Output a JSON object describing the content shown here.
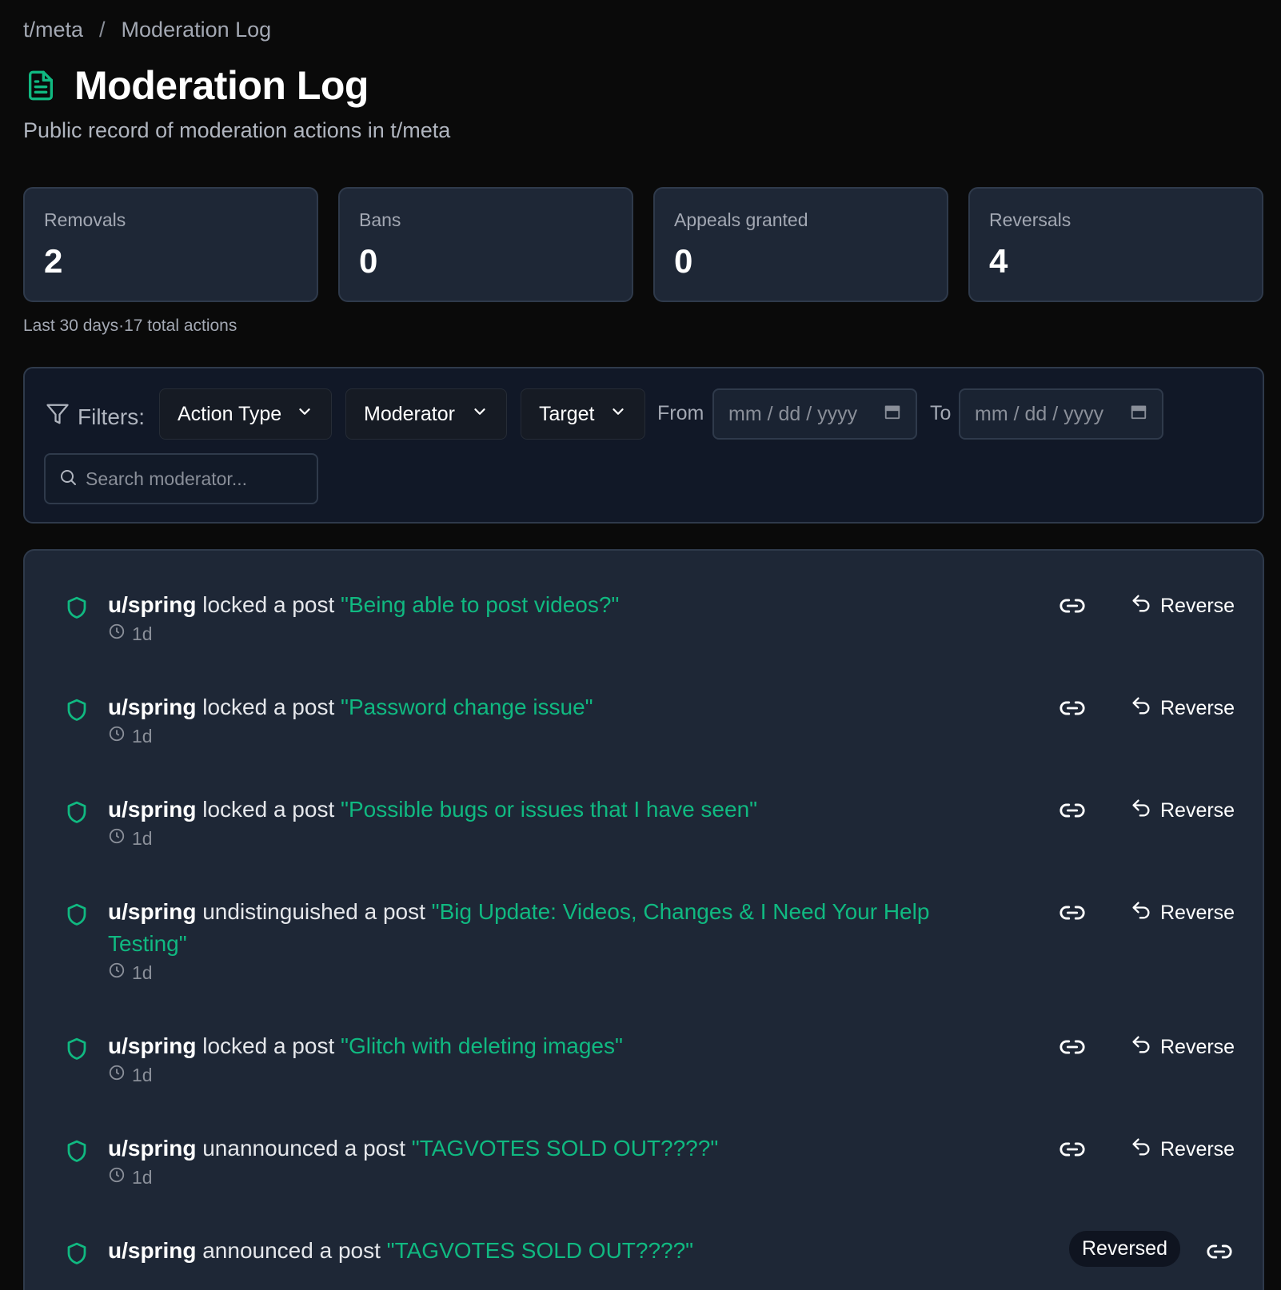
{
  "breadcrumb": {
    "community": "t/meta",
    "separator": "/",
    "current": "Moderation Log"
  },
  "header": {
    "title": "Moderation Log",
    "subtitle": "Public record of moderation actions in t/meta",
    "icon": "document-icon"
  },
  "stats": [
    {
      "label": "Removals",
      "value": "2"
    },
    {
      "label": "Bans",
      "value": "0"
    },
    {
      "label": "Appeals granted",
      "value": "0"
    },
    {
      "label": "Reversals",
      "value": "4"
    }
  ],
  "summary": {
    "period": "Last 30 days",
    "dot": "·",
    "total": "17 total actions"
  },
  "filters": {
    "label": "Filters:",
    "action_type": "Action Type",
    "moderator": "Moderator",
    "target": "Target",
    "from_label": "From",
    "to_label": "To",
    "date_placeholder": "mm / dd / yyyy",
    "search_placeholder": "Search moderator..."
  },
  "entries": [
    {
      "user": "u/spring",
      "action": " locked a post ",
      "target": "\"Being able to post videos?\"",
      "time": "1d",
      "reverse_label": "Reverse"
    },
    {
      "user": "u/spring",
      "action": " locked a post ",
      "target": "\"Password change issue\"",
      "time": "1d",
      "reverse_label": "Reverse"
    },
    {
      "user": "u/spring",
      "action": " locked a post ",
      "target": "\"Possible bugs or issues that I have seen\"",
      "time": "1d",
      "reverse_label": "Reverse"
    },
    {
      "user": "u/spring",
      "action": " undistinguished a post ",
      "target": "\"Big Update: Videos, Changes & I Need Your Help Testing\"",
      "time": "1d",
      "reverse_label": "Reverse"
    },
    {
      "user": "u/spring",
      "action": " locked a post ",
      "target": "\"Glitch with deleting images\"",
      "time": "1d",
      "reverse_label": "Reverse"
    },
    {
      "user": "u/spring",
      "action": " unannounced a post ",
      "target": "\"TAGVOTES SOLD OUT????\"",
      "time": "1d",
      "reverse_label": "Reverse"
    },
    {
      "user": "u/spring",
      "action": " announced a post ",
      "target": "\"TAGVOTES SOLD OUT????\"",
      "status": "Reversed"
    }
  ],
  "colors": {
    "accent": "#10b981",
    "background": "#0a0a0a",
    "card": "#1e2736",
    "border": "#2f3a4b"
  }
}
